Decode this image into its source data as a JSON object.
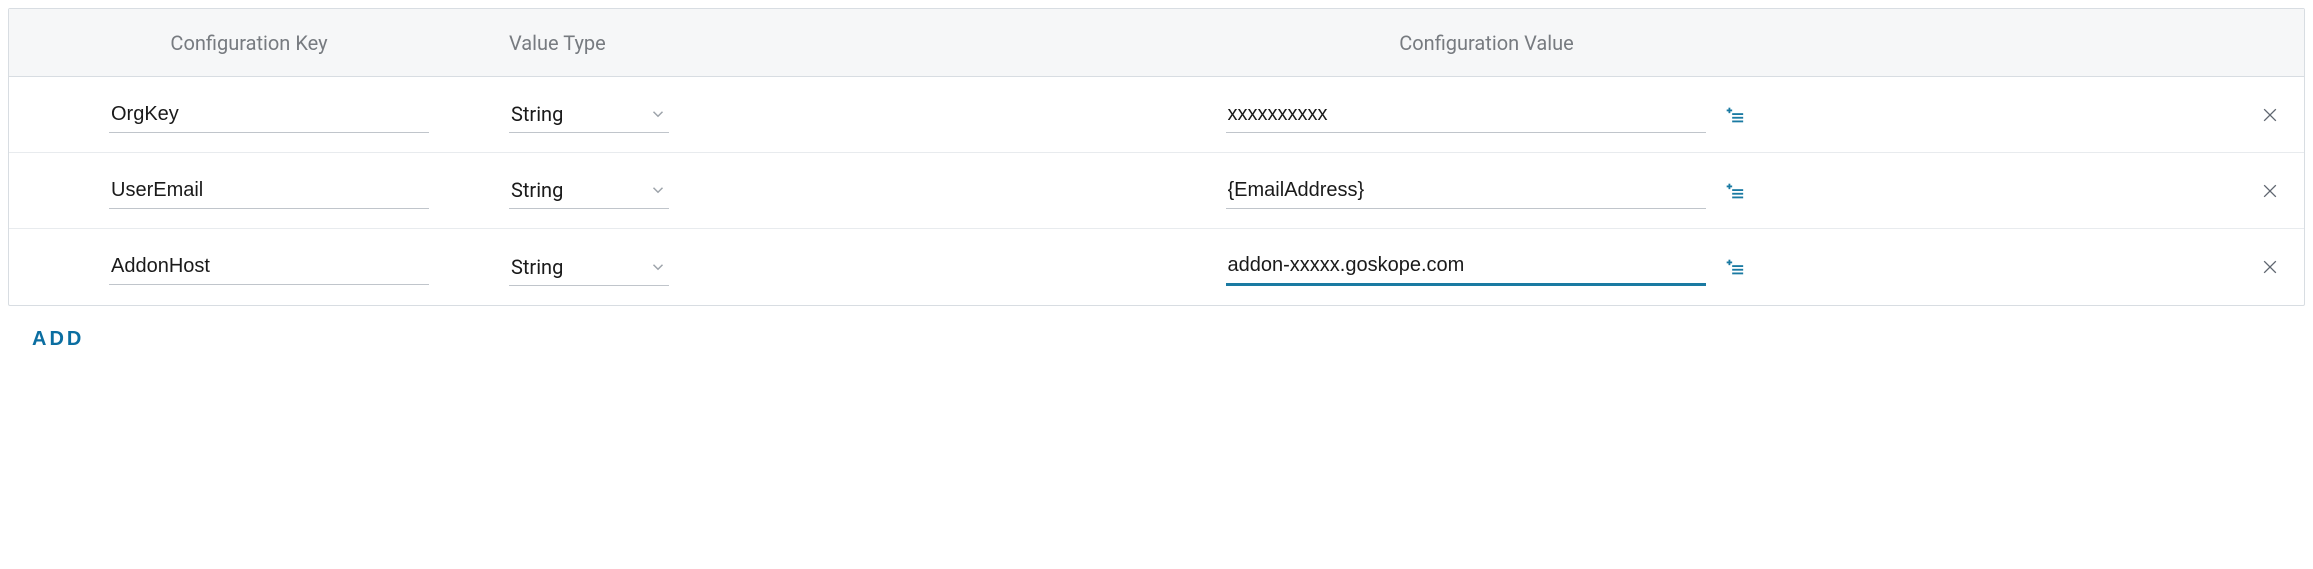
{
  "headers": {
    "key": "Configuration Key",
    "type": "Value Type",
    "value": "Configuration Value"
  },
  "rows": [
    {
      "key": "OrgKey",
      "type": "String",
      "value": "xxxxxxxxxx",
      "focused": false
    },
    {
      "key": "UserEmail",
      "type": "String",
      "value": "{EmailAddress}",
      "focused": false
    },
    {
      "key": "AddonHost",
      "type": "String",
      "value": "addon-xxxxx.goskope.com",
      "focused": true
    }
  ],
  "add_label": "ADD",
  "colors": {
    "accent": "#1a7aa2",
    "link": "#0b6ea1"
  }
}
